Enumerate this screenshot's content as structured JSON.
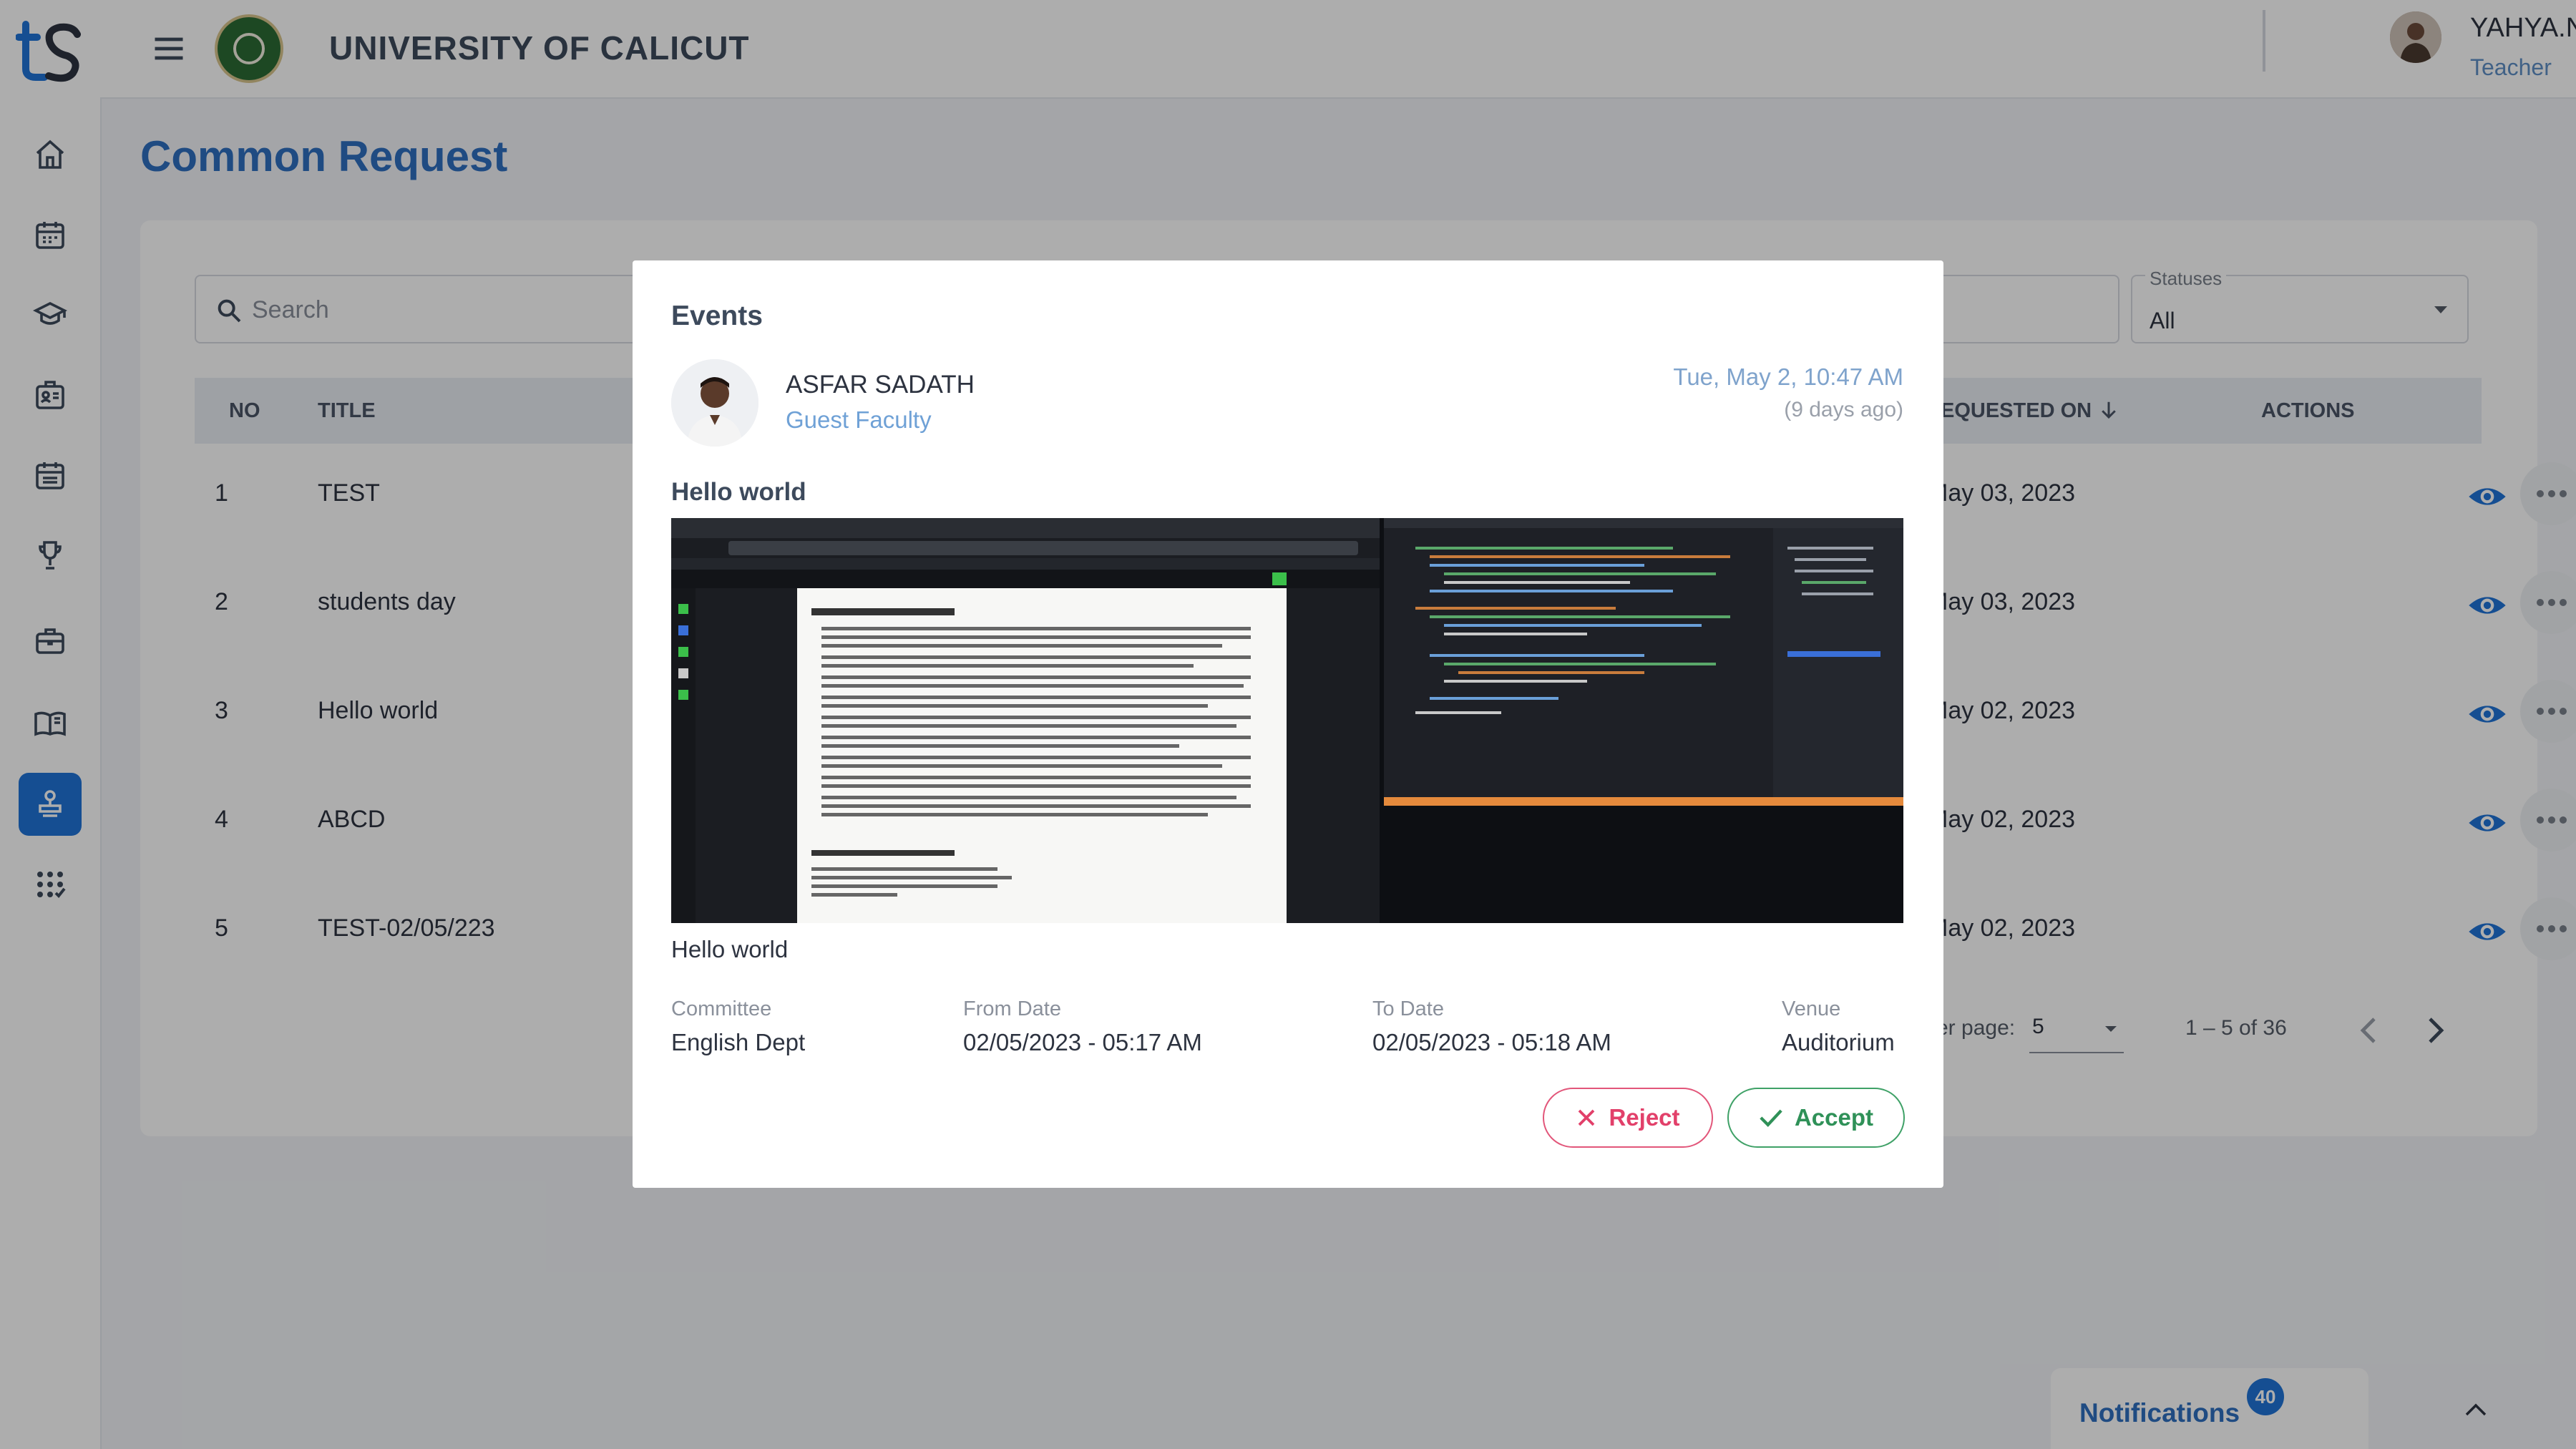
{
  "app": {
    "university_name": "UNIVERSITY OF CALICUT",
    "user": {
      "name": "YAHYA.N.V",
      "role": "Teacher"
    }
  },
  "sidebar": {
    "items": [
      {
        "icon": "home-icon"
      },
      {
        "icon": "calendar-icon"
      },
      {
        "icon": "graduation-cap-icon"
      },
      {
        "icon": "id-card-icon"
      },
      {
        "icon": "schedule-icon"
      },
      {
        "icon": "trophy-icon"
      },
      {
        "icon": "briefcase-icon"
      },
      {
        "icon": "book-icon"
      },
      {
        "icon": "request-stamp-icon",
        "active": true
      },
      {
        "icon": "apps-icon"
      }
    ]
  },
  "page": {
    "title": "Common Request",
    "search": {
      "placeholder": "Search"
    },
    "statuses": {
      "label": "Statuses",
      "value": "All"
    },
    "table": {
      "headers": {
        "no": "NO",
        "title": "TITLE",
        "requested_on": "EQUESTED ON",
        "actions": "ACTIONS"
      },
      "rows": [
        {
          "no": "1",
          "title": "TEST",
          "date": "May 03, 2023"
        },
        {
          "no": "2",
          "title": "students day",
          "date": "May 03, 2023"
        },
        {
          "no": "3",
          "title": "Hello world",
          "date": "May 02, 2023"
        },
        {
          "no": "4",
          "title": "ABCD",
          "date": "May 02, 2023"
        },
        {
          "no": "5",
          "title": "TEST-02/05/223",
          "date": "May 02, 2023"
        }
      ]
    },
    "pagination": {
      "rows_label": "er page:",
      "rows_value": "5",
      "range": "1 – 5 of 36"
    }
  },
  "modal": {
    "title": "Events",
    "author": {
      "name": "ASFAR SADATH",
      "role": "Guest Faculty"
    },
    "date": "Tue, May 2, 10:47 AM",
    "ago": "(9 days ago)",
    "heading": "Hello world",
    "caption": "Hello world",
    "fields": {
      "committee": {
        "label": "Committee",
        "value": "English Dept"
      },
      "from": {
        "label": "From Date",
        "value": "02/05/2023 - 05:17 AM"
      },
      "to": {
        "label": "To Date",
        "value": "02/05/2023 - 05:18 AM"
      },
      "venue": {
        "label": "Venue",
        "value": "Auditorium"
      }
    },
    "buttons": {
      "reject": "Reject",
      "accept": "Accept"
    }
  },
  "notifications": {
    "label": "Notifications",
    "count": "40"
  },
  "colors": {
    "accent": "#1f74d8",
    "title_blue": "#2f6fc0",
    "reject": "#e2406a",
    "accept": "#2f9158"
  }
}
